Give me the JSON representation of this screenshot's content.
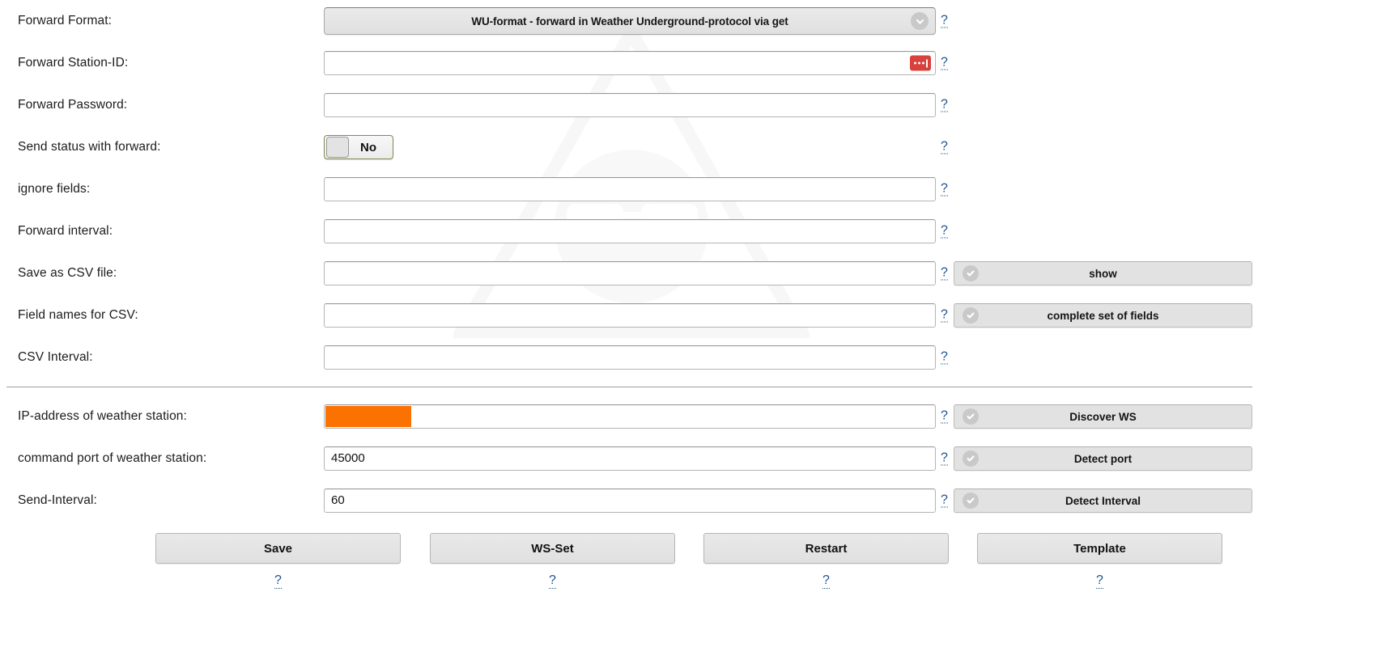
{
  "form": {
    "rows": [
      {
        "label": "Forward Format:",
        "kind": "select",
        "value": "WU-format - forward in Weather Underground-protocol via get",
        "help": "?"
      },
      {
        "label": "Forward Station-ID:",
        "kind": "text",
        "value": "",
        "placeholder": "",
        "help": "?",
        "icon": "password-manager-icon"
      },
      {
        "label": "Forward Password:",
        "kind": "text",
        "value": "",
        "placeholder": "",
        "help": "?"
      },
      {
        "label": "Send status with forward:",
        "kind": "toggle",
        "value": "No",
        "help": "?"
      },
      {
        "label": "ignore fields:",
        "kind": "text",
        "value": "",
        "placeholder": "",
        "help": "?"
      },
      {
        "label": "Forward interval:",
        "kind": "text",
        "value": "",
        "placeholder": "",
        "help": "?"
      },
      {
        "label": "Save as CSV file:",
        "kind": "text",
        "value": "",
        "placeholder": "",
        "help": "?",
        "action": "show"
      },
      {
        "label": "Field names for CSV:",
        "kind": "text",
        "value": "",
        "placeholder": "",
        "help": "?",
        "action": "complete set of fields"
      },
      {
        "label": "CSV Interval:",
        "kind": "text",
        "value": "",
        "placeholder": "",
        "help": "?"
      }
    ],
    "rows2": [
      {
        "label": "IP-address of weather station:",
        "kind": "text",
        "value": "",
        "placeholder": "",
        "redacted": true,
        "help": "?",
        "action": "Discover WS"
      },
      {
        "label": "command port of weather station:",
        "kind": "text",
        "value": "45000",
        "placeholder": "",
        "help": "?",
        "action": "Detect port"
      },
      {
        "label": "Send-Interval:",
        "kind": "text",
        "value": "60",
        "placeholder": "",
        "help": "?",
        "action": "Detect Interval"
      }
    ],
    "bottom_buttons": [
      {
        "label": "Save",
        "help": "?"
      },
      {
        "label": "WS-Set",
        "help": "?"
      },
      {
        "label": "Restart",
        "help": "?"
      },
      {
        "label": "Template",
        "help": "?"
      }
    ]
  },
  "icons": {
    "dropdown": "chevron-down-icon",
    "action": "check-circle-icon",
    "station_id": "password-manager-icon"
  },
  "colors": {
    "redaction": "#fb7200",
    "password_icon": "#d8413c",
    "help_link": "#20538d",
    "toggle_border": "#7e8b50",
    "button_face": "#e2e2e2"
  }
}
